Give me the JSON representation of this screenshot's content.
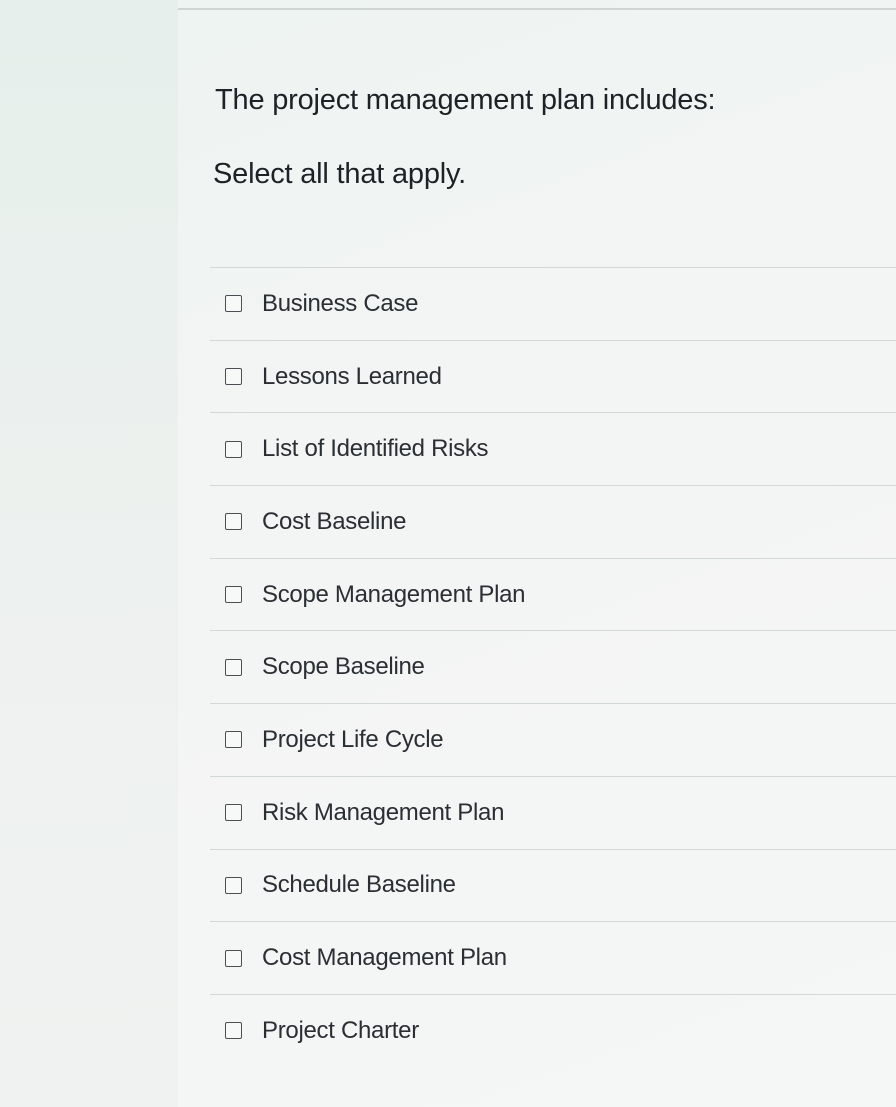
{
  "question": {
    "prompt": "The project management plan includes:",
    "instruction": "Select all that apply."
  },
  "options": [
    {
      "label": "Business Case",
      "checked": false
    },
    {
      "label": "Lessons Learned",
      "checked": false
    },
    {
      "label": "List of Identified Risks",
      "checked": false
    },
    {
      "label": "Cost Baseline",
      "checked": false
    },
    {
      "label": "Scope Management Plan",
      "checked": false
    },
    {
      "label": "Scope Baseline",
      "checked": false
    },
    {
      "label": "Project Life Cycle",
      "checked": false
    },
    {
      "label": "Risk Management Plan",
      "checked": false
    },
    {
      "label": "Schedule Baseline",
      "checked": false
    },
    {
      "label": "Cost Management Plan",
      "checked": false
    },
    {
      "label": "Project Charter",
      "checked": false
    }
  ]
}
